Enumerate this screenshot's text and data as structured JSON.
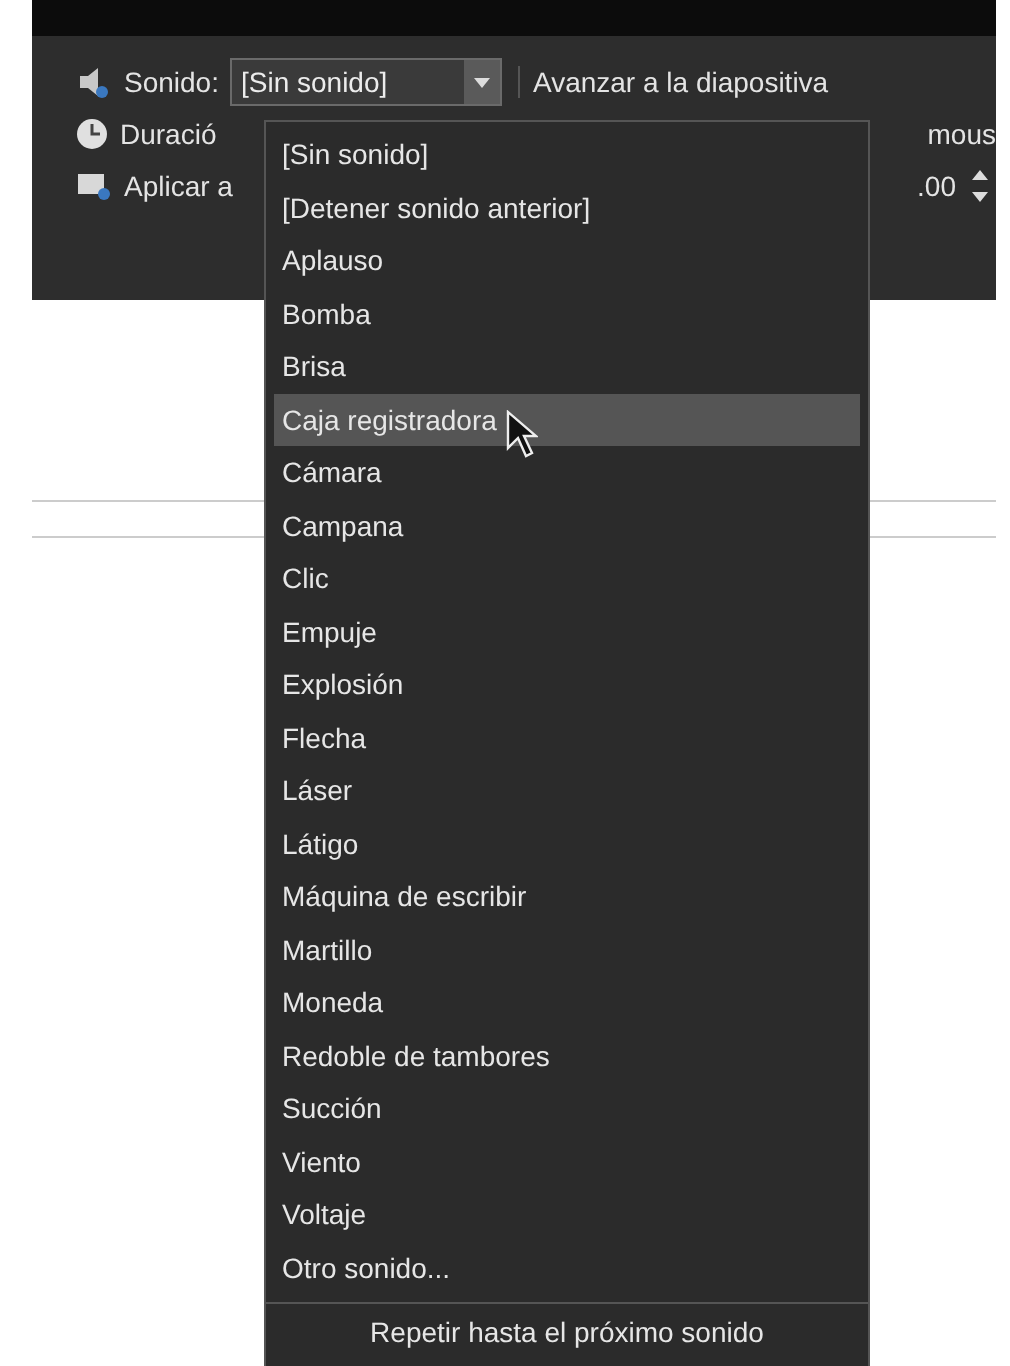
{
  "ribbon": {
    "sound_label": "Sonido:",
    "sound_value": "[Sin sonido]",
    "advance_label": "Avanzar a la diapositiva",
    "duration_label": "Duració",
    "mouse_label": "mous",
    "apply_label": "Aplicar a",
    "time_value": ".00"
  },
  "dropdown": {
    "items": [
      {
        "label": "[Sin sonido]",
        "selected": false
      },
      {
        "label": "[Detener sonido anterior]",
        "selected": false
      },
      {
        "label": "Aplauso",
        "selected": false
      },
      {
        "label": "Bomba",
        "selected": false
      },
      {
        "label": "Brisa",
        "selected": false
      },
      {
        "label": "Caja registradora",
        "selected": true
      },
      {
        "label": "Cámara",
        "selected": false
      },
      {
        "label": "Campana",
        "selected": false
      },
      {
        "label": "Clic",
        "selected": false
      },
      {
        "label": "Empuje",
        "selected": false
      },
      {
        "label": "Explosión",
        "selected": false
      },
      {
        "label": "Flecha",
        "selected": false
      },
      {
        "label": "Láser",
        "selected": false
      },
      {
        "label": "Látigo",
        "selected": false
      },
      {
        "label": "Máquina de escribir",
        "selected": false
      },
      {
        "label": "Martillo",
        "selected": false
      },
      {
        "label": "Moneda",
        "selected": false
      },
      {
        "label": "Redoble de tambores",
        "selected": false
      },
      {
        "label": "Succión",
        "selected": false
      },
      {
        "label": "Viento",
        "selected": false
      },
      {
        "label": "Voltaje",
        "selected": false
      },
      {
        "label": "Otro sonido...",
        "selected": false
      }
    ],
    "footer": "Repetir hasta el próximo sonido"
  }
}
